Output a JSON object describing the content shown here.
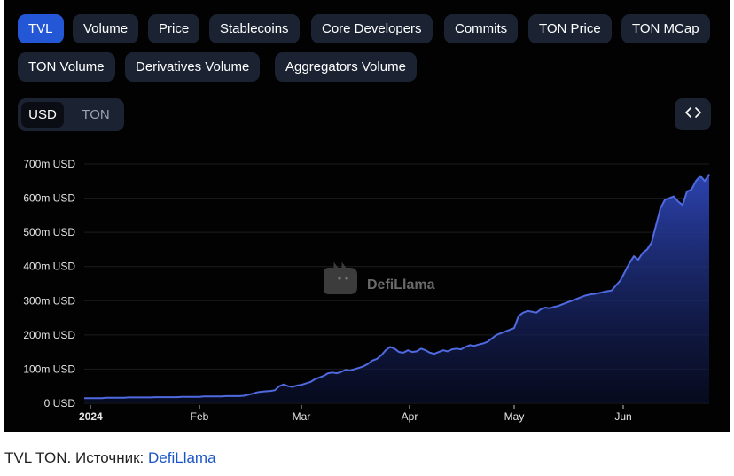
{
  "tabs": [
    {
      "label": "TVL",
      "active": true
    },
    {
      "label": "Volume",
      "active": false
    },
    {
      "label": "Price",
      "active": false
    },
    {
      "label": "Stablecoins",
      "active": false
    },
    {
      "label": "Core Developers",
      "active": false
    },
    {
      "label": "Commits",
      "active": false
    },
    {
      "label": "TON Price",
      "active": false
    },
    {
      "label": "TON MCap",
      "active": false
    },
    {
      "label": "TON Volume",
      "active": false
    },
    {
      "label": "Derivatives Volume",
      "active": false
    },
    {
      "label": "Aggregators Volume",
      "active": false
    }
  ],
  "currency": {
    "options": [
      "USD",
      "TON"
    ],
    "selected": "USD"
  },
  "embed_icon": "code-brackets-icon",
  "watermark": {
    "text": "DefiLlama",
    "icon": "llama-logo-icon"
  },
  "colors": {
    "line": "#4f6ae0",
    "active_tab": "#2457d6",
    "pill": "#1b2333"
  },
  "chart_data": {
    "type": "area",
    "title": "",
    "xlabel": "",
    "ylabel": "",
    "x_ticks": [
      "2024",
      "Feb",
      "Mar",
      "Apr",
      "May",
      "Jun"
    ],
    "y_ticks": [
      "0 USD",
      "100m USD",
      "200m USD",
      "300m USD",
      "400m USD",
      "500m USD",
      "600m USD",
      "700m USD"
    ],
    "ylim": [
      0,
      700
    ],
    "unit": "m USD",
    "grid": true,
    "series": [
      {
        "values": [
          15,
          15,
          15,
          15,
          15,
          16,
          16,
          16,
          16,
          16,
          17,
          17,
          17,
          17,
          17,
          17,
          18,
          18,
          18,
          18,
          18,
          18,
          19,
          19,
          19,
          19,
          19,
          20,
          20,
          20,
          20,
          20,
          21,
          21,
          21,
          21,
          22,
          25,
          28,
          32,
          34,
          35,
          36,
          38,
          50,
          55,
          50,
          48,
          52,
          54,
          58,
          62,
          70,
          75,
          80,
          88,
          90,
          88,
          92,
          98,
          96,
          100,
          104,
          108,
          115,
          125,
          130,
          140,
          155,
          165,
          160,
          150,
          148,
          155,
          150,
          152,
          160,
          155,
          148,
          145,
          150,
          155,
          152,
          158,
          160,
          158,
          165,
          170,
          168,
          172,
          175,
          180,
          190,
          200,
          205,
          210,
          215,
          220,
          255,
          265,
          270,
          268,
          265,
          275,
          280,
          278,
          282,
          285,
          290,
          295,
          300,
          305,
          310,
          315,
          318,
          320,
          322,
          325,
          328,
          330,
          345,
          360,
          385,
          410,
          430,
          420,
          440,
          450,
          470,
          520,
          570,
          595,
          600,
          605,
          590,
          580,
          620,
          625,
          650,
          665,
          650,
          670
        ]
      }
    ]
  },
  "caption": {
    "text": "TVL TON. Источник: ",
    "link": "DefiLlama"
  }
}
